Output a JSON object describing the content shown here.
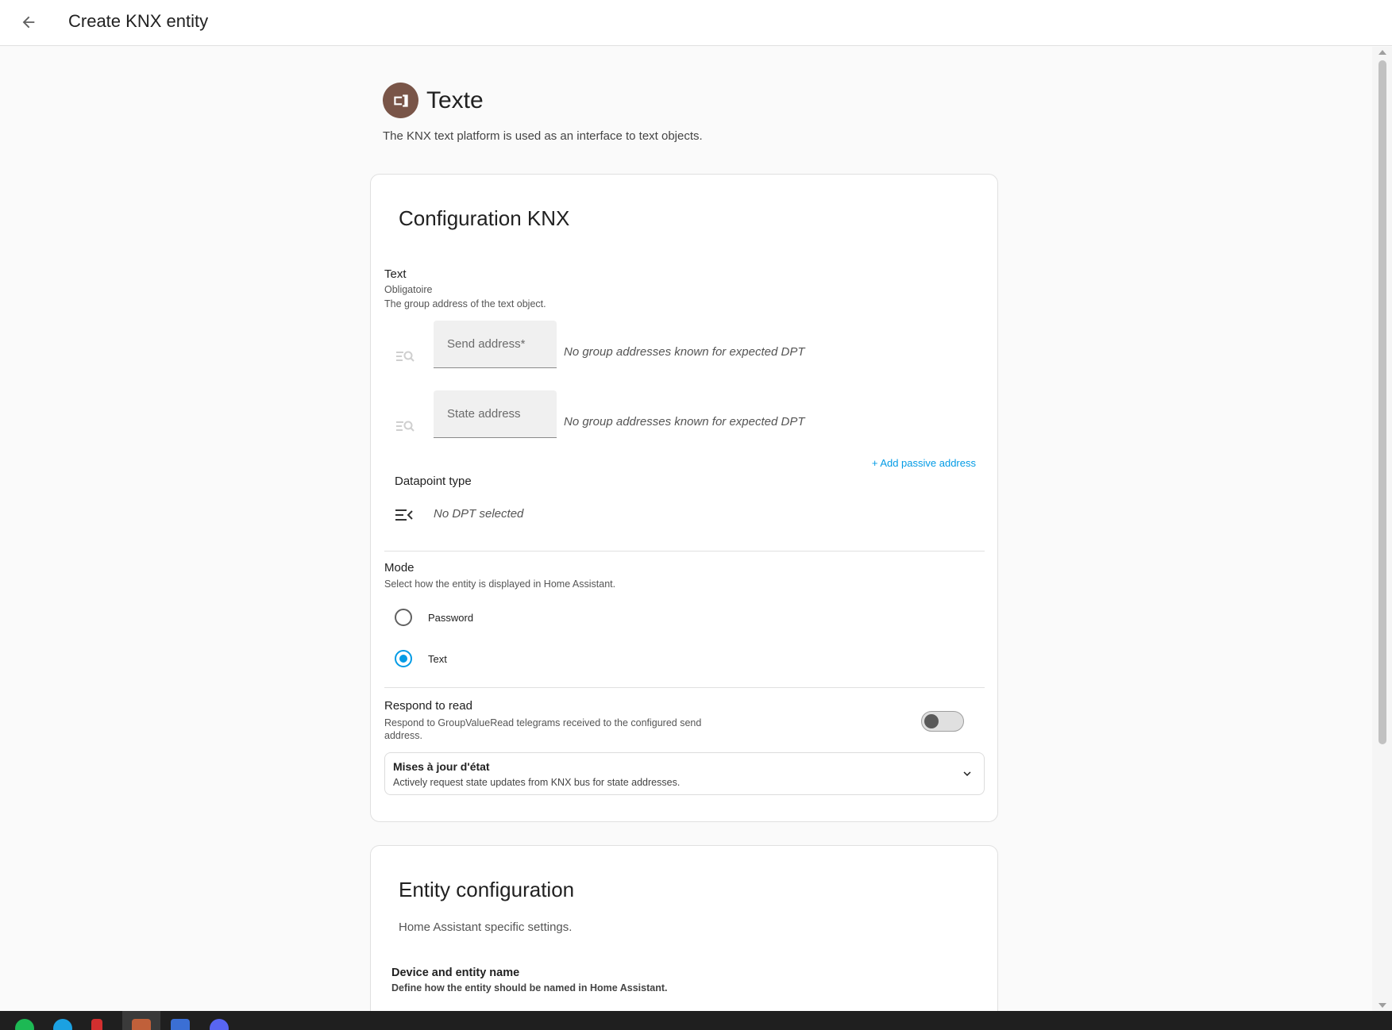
{
  "header": {
    "title": "Create KNX entity",
    "back_icon": "arrow-left-icon"
  },
  "platform": {
    "name": "Texte",
    "description": "The KNX text platform is used as an interface to text objects.",
    "icon": "text-box-icon",
    "icon_color": "#795548"
  },
  "knx_card": {
    "title": "Configuration KNX",
    "text_field": {
      "label": "Text",
      "required": "Obligatoire",
      "description": "The group address of the text object."
    },
    "send_address": {
      "placeholder": "Send address*",
      "note": "No group addresses known for expected DPT"
    },
    "state_address": {
      "placeholder": "State address",
      "note": "No group addresses known for expected DPT"
    },
    "add_passive": "+ Add passive address",
    "dpt": {
      "label": "Datapoint type",
      "note": "No DPT selected"
    },
    "mode": {
      "label": "Mode",
      "description": "Select how the entity is displayed in Home Assistant.",
      "options": [
        {
          "label": "Password",
          "checked": false
        },
        {
          "label": "Text",
          "checked": true
        }
      ]
    },
    "respond_to_read": {
      "label": "Respond to read",
      "description": "Respond to GroupValueRead telegrams received to the configured send address.",
      "enabled": false
    },
    "state_updates": {
      "title": "Mises à jour d'état",
      "description": "Actively request state updates from KNX bus for state addresses."
    }
  },
  "entity_card": {
    "title": "Entity configuration",
    "description": "Home Assistant specific settings.",
    "device_name": {
      "label": "Device and entity name",
      "description": "Define how the entity should be named in Home Assistant."
    }
  },
  "taskbar": {
    "apps": [
      "spotify-icon",
      "edge-icon",
      "app-red-icon",
      "app-active-icon",
      "terminal-icon",
      "discord-icon"
    ]
  },
  "colors": {
    "accent": "#039be5",
    "background": "#fafafa"
  }
}
